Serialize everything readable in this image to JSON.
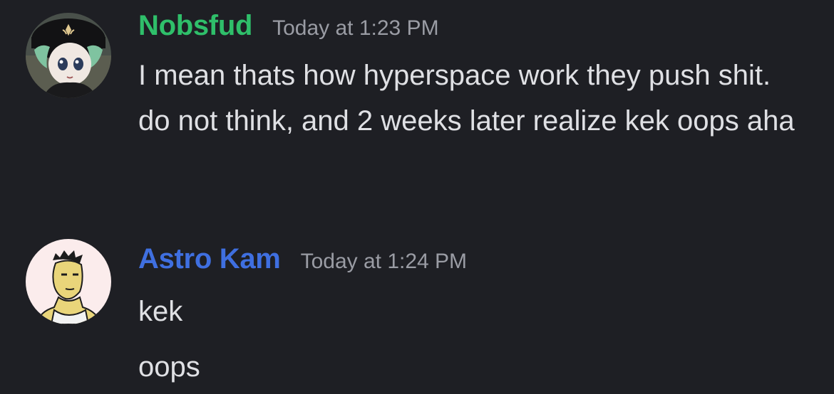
{
  "colors": {
    "background": "#1e1f24",
    "nobsfud_name": "#2fbf6a",
    "astro_name": "#3f6fe0",
    "timestamp": "#9a9ca4",
    "text": "#dfe0e4"
  },
  "messages": [
    {
      "author": "Nobsfud",
      "timestamp": "Today at 1:23 PM",
      "avatar_icon": "anime-avatar-icon",
      "lines": [
        "I mean thats how hyperspace work they push shit. do not think, and 2 weeks later realize kek oops aha"
      ]
    },
    {
      "author": "Astro Kam",
      "timestamp": "Today at 1:24 PM",
      "avatar_icon": "sketch-portrait-avatar-icon",
      "lines": [
        "kek",
        "oops"
      ]
    }
  ]
}
